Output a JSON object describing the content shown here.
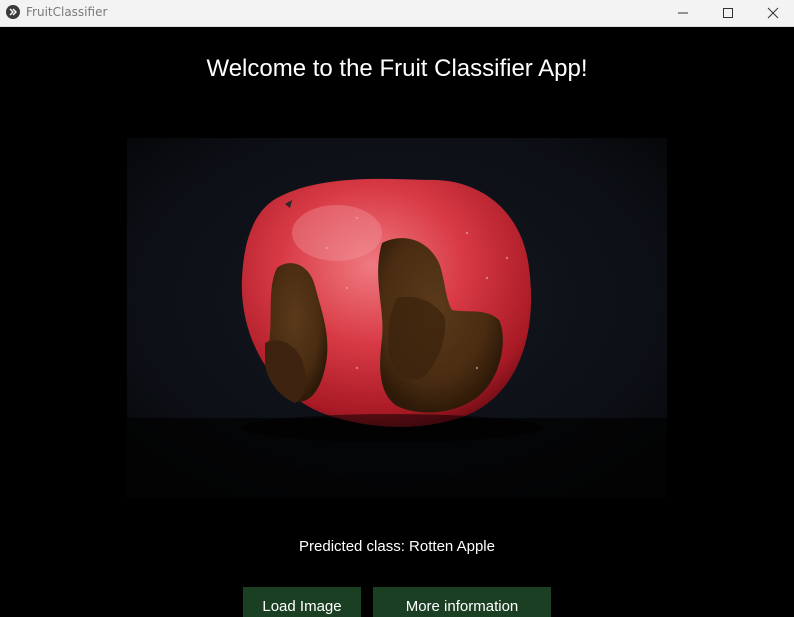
{
  "window": {
    "title": "FruitClassifier",
    "icon": "kivy-app-icon"
  },
  "window_controls": {
    "minimize_icon": "minimize-icon",
    "maximize_icon": "maximize-icon",
    "close_icon": "close-icon"
  },
  "main": {
    "heading": "Welcome to the Fruit Classifier App!",
    "image_subject": "rotten apple photo",
    "prediction": "Predicted class: Rotten Apple",
    "buttons": {
      "load_image": "Load Image",
      "more_info": "More information"
    }
  },
  "colors": {
    "background": "#000000",
    "button": "#1b3f22",
    "titlebar": "#f3f3f3"
  }
}
